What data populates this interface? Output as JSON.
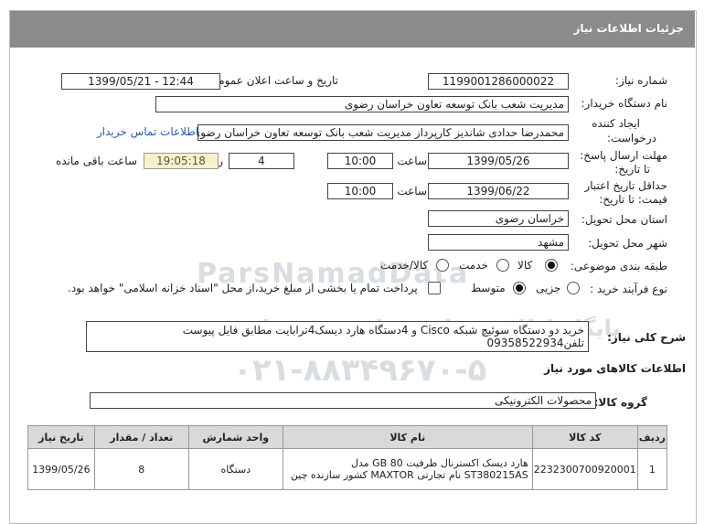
{
  "header": {
    "title": "جزئیات اطلاعات نیاز"
  },
  "fields": {
    "need_number_label": "شماره نیاز:",
    "need_number": "1199001286000022",
    "announce_label": "تاریخ و ساعت اعلان عمومی:",
    "announce_value": "1399/05/21 - 12:44",
    "buyer_label": "نام دستگاه خریدار:",
    "buyer_value": "مدیریت شعب بانک توسعه تعاون خراسان رضوی",
    "creator_label_1": "ایجاد کننده",
    "creator_label_2": "درخواست:",
    "creator_value": "محمدرضا حدادی شاندیز کارپرداز مدیریت شعب بانک توسعه تعاون خراسان رضوی",
    "contact_link": "اطلاعات تماس خریدار",
    "deadline_label_1": "مهلت ارسال پاسخ:",
    "deadline_label_2": "تا تاریخ:",
    "deadline_date": "1399/05/26",
    "time_label": "ساعت",
    "deadline_time": "10:00",
    "days_value": "4",
    "days_label": "روز و",
    "remaining_time": "19:05:18",
    "remaining_label": "ساعت باقی مانده",
    "validity_label_1": "حداقل تاریخ اعتبار",
    "validity_label_2": "قیمت: تا تاریخ:",
    "validity_date": "1399/06/22",
    "validity_time": "10:00",
    "province_label": "استان محل تحویل:",
    "province_value": "خراسان رضوی",
    "city_label": "شهر محل تحویل:",
    "city_value": "مشهد",
    "category_label": "طبقه بندی موضوعی:",
    "category_options": [
      "کالا",
      "خدمت",
      "کالا/خدمت"
    ],
    "purchase_label": "نوع فرآیند خرید :",
    "purchase_options": [
      "جزیی",
      "متوسط"
    ],
    "payment_note": "پرداخت تمام یا بخشی از مبلغ خرید،از محل \"اسناد خزانه اسلامی\" خواهد بود.",
    "general_desc_label": "شرح کلی نیاز:",
    "general_desc": "خرید دو دستگاه سوئیچ شبکه Cisco و 4دستگاه هارد دیسک4ترابایت مطابق فایل پیوست تلفن09358522934",
    "goods_info_title": "اطلاعات کالاهای مورد نیاز",
    "goods_group_label": "گروه کالا:",
    "goods_group_value": "محصولات الکترونیکی"
  },
  "table": {
    "headers": [
      "ردیف",
      "کد کالا",
      "نام کالا",
      "واحد شمارش",
      "تعداد / مقدار",
      "تاریخ نیاز"
    ],
    "rows": [
      {
        "row": "1",
        "code": "2232300700920001",
        "name": "هارد دیسک اکسترنال ظرفیت 80 GB مدل ST380215AS نام تجارتی MAXTOR کشور سازنده چین",
        "unit": "دستگاه",
        "qty": "8",
        "date": "1399/05/26"
      }
    ]
  },
  "watermark": {
    "brand": "ParsNamadData",
    "line1": "پایگاه اطلاع رسانی مناقصه و مزایده",
    "line2": "۰۲۱-۸۸۳۴۹۶۷۰-۵"
  }
}
